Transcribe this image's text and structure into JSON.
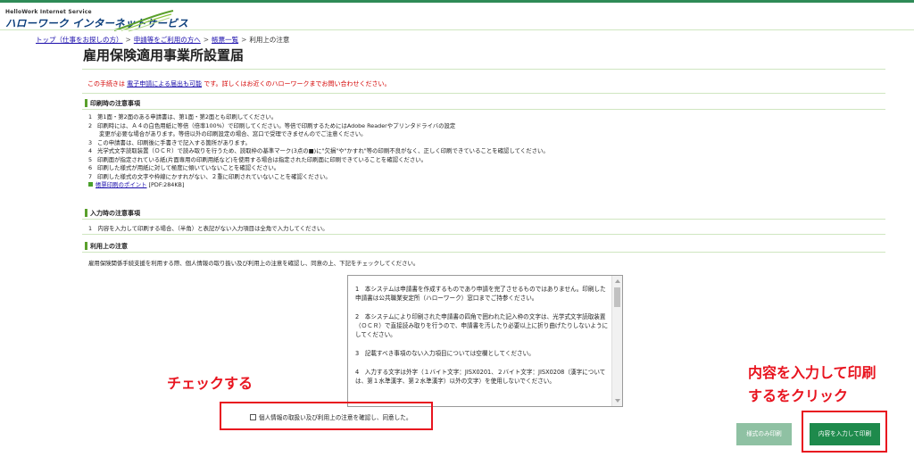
{
  "header": {
    "service_label": "HelloWork Internet Service",
    "site_name": "ハローワーク インターネットサービス"
  },
  "breadcrumb": {
    "items": [
      "トップ（仕事をお探しの方）",
      "申請等をご利用の方へ",
      "帳票一覧"
    ],
    "current": "利用上の注意",
    "separator": ">"
  },
  "page": {
    "title": "雇用保険適用事業所設置届"
  },
  "notice": {
    "prefix": "この手続きは ",
    "link": "電子申請による届出も可能",
    "suffix": " です。詳しくはお近くのハローワークまでお問い合わせください。"
  },
  "sections": {
    "print_notes": {
      "heading": "印刷時の注意事項",
      "items": [
        {
          "num": "1",
          "text": "第1面・第2面のある申請書は、第1面・第2面とも印刷してください。"
        },
        {
          "num": "2",
          "text": "印刷時には、Ａ４の白色用紙に等倍（倍率100%）で印刷してください。等倍で印刷するためにはAdobe Readerやプリンタドライバの設定"
        },
        {
          "num": "",
          "text": "変更が必要な場合があります。等倍以外の印刷設定の場合、窓口で受理できませんのでご注意ください。"
        },
        {
          "num": "3",
          "text": "この申請書は、印刷後に手書きで記入する箇所があります。"
        },
        {
          "num": "4",
          "text": "光学式文字読取装置（ＯＣＲ）で読み取りを行うため、読取枠の基準マーク(3点の■)に\"欠損\"や\"かすれ\"等の印刷不良がなく、正しく印刷できていることを確認してください。"
        },
        {
          "num": "5",
          "text": "印刷面が指定されている紙(片面専用の印刷用紙など)を使用する場合は指定された印刷面に印刷できていることを確認ください。"
        },
        {
          "num": "6",
          "text": "印刷した様式が用紙に対して極度に傾いていないことを確認ください。"
        },
        {
          "num": "7",
          "text": "印刷した様式の文字や枠線にかすれがない、２重に印刷されていないことを確認ください。"
        }
      ],
      "point_link": "帳票印刷のポイント",
      "point_link_suffix": " [PDF:284KB]"
    },
    "input_notes": {
      "heading": "入力時の注意事項",
      "text": "1　内容を入力して印刷する場合、（半角）と表記がない入力項目は全角で入力してください。"
    },
    "usage_notes": {
      "heading": "利用上の注意",
      "text": "雇用保険関係手続支援を利用する際、個人情報の取り扱い及び利用上の注意を確認し、同意の上、下記をチェックしてください。"
    }
  },
  "terms": {
    "paragraphs": [
      "1　本システムは申請書を作成するものであり申請を完了させるものではありません。印刷した申請書は公共職業安定所（ハローワーク）窓口までご持参ください。",
      "2　本システムにより印刷された申請書の四角で囲われた記入枠の文字は、光学式文字読取装置（ＯＣＲ）で直接読み取りを行うので、申請書を汚したり必要以上に折り曲げたりしないようにしてください。",
      "3　記載すべき事項のない入力項目については空欄としてください。",
      "4　入力する文字は外字（１バイト文字：JISX0201、２バイト文字：JISX0208（漢字については、第１水準漢字、第２水準漢字）以外の文字）を使用しないでください。"
    ]
  },
  "consent": {
    "label": "個人情報の取扱い及び利用上の注意を確認し、同意した。",
    "checked": false
  },
  "annotations": {
    "check": "チェックする",
    "print_line1": "内容を入力して印刷",
    "print_line2": "するをクリック"
  },
  "buttons": {
    "form_only": "様式のみ印刷",
    "input_and_print": "内容を入力して印刷"
  },
  "colors": {
    "accent_green": "#1e8a4c",
    "annotation_red": "#e8141f",
    "notice_red": "#d40000",
    "link_blue": "#1a0dab"
  }
}
